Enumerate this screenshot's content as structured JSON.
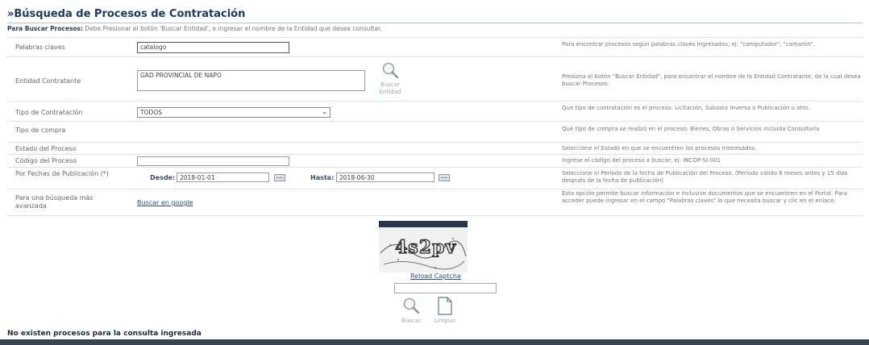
{
  "header": {
    "title": "»Búsqueda de Procesos de Contratación",
    "instruction_bold": "Para Buscar Procesos:",
    "instruction_text": " Debe Presionar el botón 'Buscar Entidad', e ingresar el nombre de la Entidad que desea consultar."
  },
  "form": {
    "keywords": {
      "label": "Palabras claves",
      "value": "catalogo",
      "help": "Para encontrar procesos según palabras claves ingresadas; ej: \"computador\", \"camarón\"."
    },
    "entity": {
      "label": "Entidad Contratante",
      "value": "GAD PROVINCIAL DE NAPO",
      "button_label_1": "Buscar",
      "button_label_2": "Entidad",
      "help": "Presiona el botón \"Buscar Entidad\", para encontrar el nombre de la Entidad Contratante, de la cual desea buscar Procesos."
    },
    "contract_type": {
      "label": "Tipo de Contratación",
      "value": "TODOS",
      "help": "Que tipo de contratación es el proceso: Licitación, Subasta Inversa o Publicación u otro."
    },
    "purchase_type": {
      "label": "Tipo de compra",
      "help": "Qué tipo de compra se realizó en el proceso: Bienes, Obras o Servicios incluida Consultoría"
    },
    "process_state": {
      "label": "Estado del Proceso",
      "help": "Seleccione el Estado en que se encuentren los procesos interesados."
    },
    "process_code": {
      "label": "Código del Proceso",
      "value": "",
      "help": "Ingrese el código del proceso a buscar; ej: INCOP-SI-001"
    },
    "dates": {
      "label": "Por Fechas de Publicación (*)",
      "from_label": "Desde:",
      "from_value": "2018-01-01",
      "to_label": "Hasta:",
      "to_value": "2018-06-30",
      "help": "Seleccione el Período de la fecha de Publicación del Proceso. (Período válido 6 meses antes y 15 días después de la fecha de publicación)"
    },
    "advanced": {
      "label": "Para una búsqueda más avanzada",
      "link": "Buscar en google",
      "help": "Esta opción permite buscar información e inclusive documentos que se encuentren en el Portal. Para acceder puede ingresar en el campo \"Palabras claves\" lo que necesita buscar y clic en el enlace."
    }
  },
  "captcha": {
    "text": "4s2pv",
    "reload_label": "Reload Captcha",
    "input_value": ""
  },
  "actions": {
    "search_label": "Buscar",
    "clear_label": "Limpiar"
  },
  "result": {
    "message": "No existen procesos para la consulta ingresada"
  }
}
